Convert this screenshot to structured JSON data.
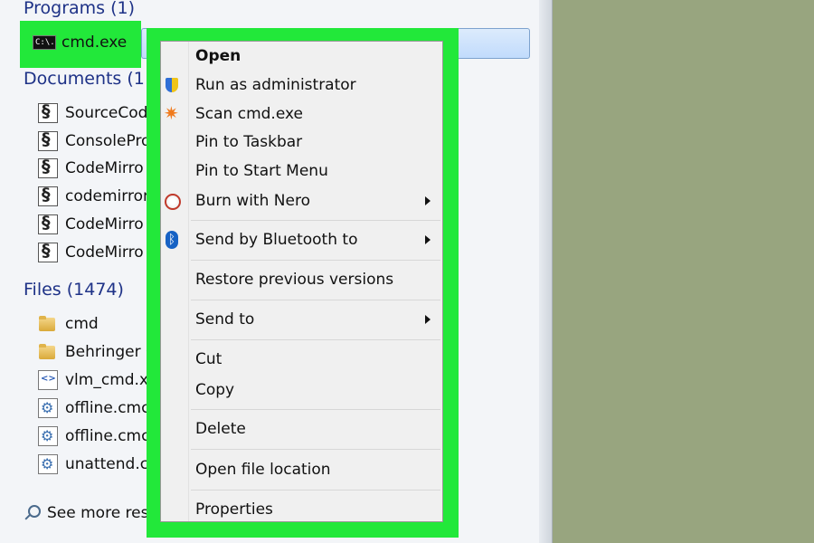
{
  "start_menu": {
    "programs_header": "Programs (1)",
    "program_item": "cmd.exe",
    "cmd_icon_text": "C:\\.",
    "documents_header": "Documents (1",
    "documents": [
      "SourceCod",
      "ConsolePro",
      "CodeMirro",
      "codemirror",
      "CodeMirro",
      "CodeMirro"
    ],
    "files_header": "Files (1474)",
    "files": [
      "cmd",
      "Behringer C",
      "vlm_cmd.x",
      "offline.cmc",
      "offline.cmc",
      "unattend.cu"
    ],
    "see_more": "See more resu"
  },
  "context_menu": {
    "open": "Open",
    "run_as_admin": "Run as administrator",
    "scan": "Scan cmd.exe",
    "pin_taskbar": "Pin to Taskbar",
    "pin_start": "Pin to Start Menu",
    "burn_nero": "Burn with Nero",
    "send_bluetooth": "Send by Bluetooth to",
    "restore_versions": "Restore previous versions",
    "send_to": "Send to",
    "cut": "Cut",
    "copy": "Copy",
    "delete": "Delete",
    "open_location": "Open file location",
    "properties": "Properties"
  },
  "colors": {
    "highlight": "#22e83a",
    "background": "#98a57f",
    "header_text": "#1e3287"
  },
  "icons": {
    "shield": "uac-shield-icon",
    "avast": "avast-icon",
    "nero": "nero-icon",
    "bluetooth": "bluetooth-icon"
  }
}
